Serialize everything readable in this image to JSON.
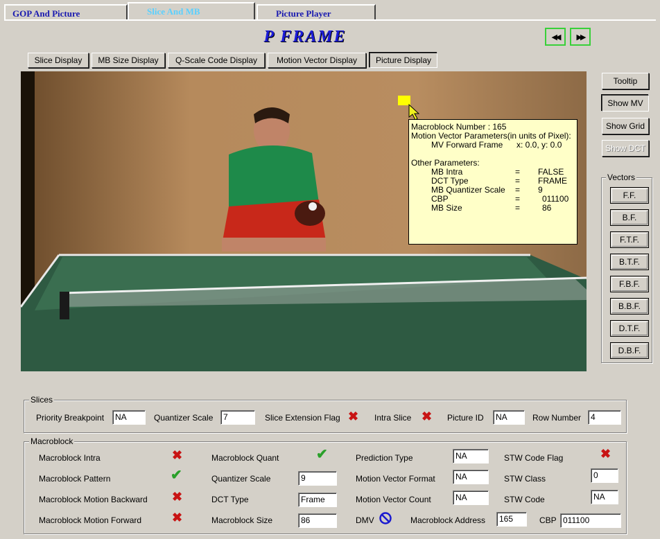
{
  "tabs": [
    {
      "label": "GOP  And  Picture"
    },
    {
      "label": "Slice  And  MB"
    },
    {
      "label": "Picture  Player"
    }
  ],
  "frame_title": "P FRAME",
  "nav": {
    "prev_icon": "rewind-icon",
    "next_icon": "fast-forward-icon",
    "prev_glyph": "◀◀",
    "next_glyph": "▶▶"
  },
  "display_buttons": [
    "Slice Display",
    "MB Size Display",
    "Q-Scale Code Display",
    "Motion Vector Display",
    "Picture Display"
  ],
  "side_buttons": {
    "tooltip": "Tooltip",
    "show_mv": "Show MV",
    "show_grid": "Show Grid",
    "show_dct": "Show DCT"
  },
  "vectors": {
    "title": "Vectors",
    "buttons": [
      "F.F.",
      "B.F.",
      "F.T.F.",
      "B.T.F.",
      "F.B.F.",
      "B.B.F.",
      "D.T.F.",
      "D.B.F."
    ]
  },
  "tooltip": {
    "mb_number": "Macroblock Number : 165",
    "mv_header": "Motion Vector Parameters(in units of Pixel):",
    "mv_forward_label": "MV Forward Frame",
    "mv_forward_value": "x: 0.0, y: 0.0",
    "other_header": "Other Parameters:",
    "params": [
      {
        "name": "MB Intra",
        "eq": "=",
        "value": "FALSE"
      },
      {
        "name": "DCT Type",
        "eq": "=",
        "value": "FRAME"
      },
      {
        "name": "MB Quantizer Scale",
        "eq": "=",
        "value": "9"
      },
      {
        "name": "CBP",
        "eq": "=",
        "value": "011100"
      },
      {
        "name": "MB Size",
        "eq": "=",
        "value": "86"
      }
    ]
  },
  "slices": {
    "title": "Slices",
    "priority_breakpoint_label": "Priority Breakpoint",
    "priority_breakpoint_value": "NA",
    "quantizer_scale_label": "Quantizer Scale",
    "quantizer_scale_value": "7",
    "slice_extension_flag_label": "Slice Extension Flag",
    "intra_slice_label": "Intra Slice",
    "picture_id_label": "Picture ID",
    "picture_id_value": "NA",
    "row_number_label": "Row Number",
    "row_number_value": "4"
  },
  "macroblock": {
    "title": "Macroblock",
    "intra_label": "Macroblock Intra",
    "pattern_label": "Macroblock Pattern",
    "motion_backward_label": "Macroblock Motion Backward",
    "motion_forward_label": "Macroblock Motion Forward",
    "quant_label": "Macroblock Quant",
    "quantizer_scale_label": "Quantizer Scale",
    "quantizer_scale_value": "9",
    "dct_type_label": "DCT Type",
    "dct_type_value": "Frame",
    "mb_size_label": "Macroblock Size",
    "mb_size_value": "86",
    "prediction_type_label": "Prediction Type",
    "prediction_type_value": "NA",
    "mv_format_label": "Motion Vector Format",
    "mv_format_value": "NA",
    "mv_count_label": "Motion Vector Count",
    "mv_count_value": "NA",
    "dmv_label": "DMV",
    "mb_address_label": "Macroblock Address",
    "mb_address_value": "165",
    "stw_code_flag_label": "STW Code Flag",
    "stw_class_label": "STW Class",
    "stw_class_value": "0",
    "stw_code_label": "STW Code",
    "stw_code_value": "NA",
    "cbp_label": "CBP",
    "cbp_value": "011100"
  },
  "colors": {
    "accent_tab": "#5ad0ff",
    "frame_title": "#1c1cd8",
    "cross": "#c81414",
    "check": "#2aa02a",
    "nav_border": "#39d039",
    "tooltip_bg": "#ffffc8"
  }
}
